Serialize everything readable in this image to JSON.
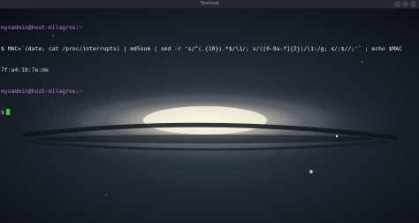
{
  "window": {
    "title": "Terminal"
  },
  "terminal": {
    "prompt1": {
      "user_host": "mysadmin@host-milagros",
      "separator": ":",
      "path": "~"
    },
    "command_line": "$ MAC=`(date; cat /proc/interrupts) | md5sum | sed -r 's/^(.{10}).*$/\\1/; s/([0-9a-f]{2})/\\1:/g; s/:$//;'` ; echo $MAC",
    "output": "7f:a4:18:7e:de",
    "prompt2": {
      "user_host": "mysadmin@host-milagros",
      "separator": ":",
      "path": "~"
    },
    "prompt_symbol": "$"
  },
  "colors": {
    "user_host": "#c678dd",
    "path": "#61afef",
    "cursor": "#35c74a"
  }
}
